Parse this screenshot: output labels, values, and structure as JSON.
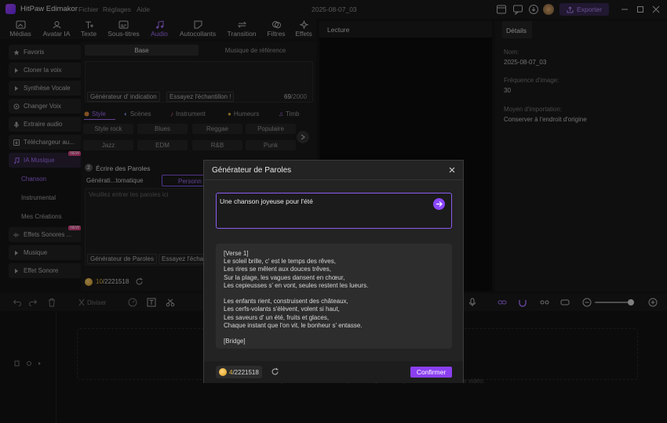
{
  "app": {
    "name": "HitPaw Edimakor",
    "date": "2025-08-07_03",
    "export_label": "Exporter"
  },
  "menu": [
    "Fichier",
    "Réglages",
    "Aide"
  ],
  "toolbar": {
    "items": [
      {
        "label": "Médias",
        "icon": "media-icon"
      },
      {
        "label": "Avatar IA",
        "icon": "avatar-icon"
      },
      {
        "label": "Texte",
        "icon": "text-icon"
      },
      {
        "label": "Sous-titres",
        "icon": "subtitles-icon"
      },
      {
        "label": "Audio",
        "icon": "audio-icon",
        "active": true
      },
      {
        "label": "Autocollants",
        "icon": "stickers-icon"
      },
      {
        "label": "Transition",
        "icon": "transition-icon"
      },
      {
        "label": "Filtres",
        "icon": "filters-icon"
      },
      {
        "label": "Effets",
        "icon": "effects-icon"
      }
    ]
  },
  "sidebar": {
    "items": [
      {
        "label": "Favoris"
      },
      {
        "label": "Cloner la voix"
      },
      {
        "label": "Synthèse Vocale"
      },
      {
        "label": "Changer Voix"
      },
      {
        "label": "Extraire audio"
      },
      {
        "label": "Téléchargeur au..."
      },
      {
        "label": "IA Musique",
        "badge": "NEW",
        "active": true
      },
      {
        "label": "Effets Sonores ...",
        "badge": "NEW"
      },
      {
        "label": "Musique"
      },
      {
        "label": "Effet Sonore"
      }
    ],
    "sub_items": [
      {
        "label": "Chanson",
        "active": true
      },
      {
        "label": "Instrumental"
      },
      {
        "label": "Mes Créations"
      }
    ]
  },
  "center": {
    "tabs": [
      "Base",
      "Musique de référence"
    ],
    "prompt_buttons": [
      "Générateur d' indication",
      "Essayez l'échantillon !"
    ],
    "char_count": "69",
    "char_max": "/2000",
    "style_tabs": [
      "Style",
      "Scènes",
      "Instrument",
      "Humeurs",
      "Timb"
    ],
    "chips": [
      "Style rock",
      "Blues",
      "Reggae",
      "Populaire",
      "Jazz",
      "EDM",
      "R&B",
      "Punk"
    ],
    "lyrics_section": {
      "number": "2",
      "title": "Écrire des Paroles",
      "tab_auto": "Générati...tomatique",
      "tab_custom": "Personn",
      "placeholder": "Veuillez entrer les paroles ici",
      "buttons": [
        "Générateur de Paroles",
        "Essayez l'échan"
      ]
    },
    "credits": {
      "used": "10",
      "total": "/2221518"
    }
  },
  "preview": {
    "title": "Lecture"
  },
  "details": {
    "tab": "Détails",
    "fields": [
      {
        "label": "Nom:",
        "value": "2025-08-07_03"
      },
      {
        "label": "Fréquence d'image:",
        "value": "30"
      },
      {
        "label": "Moyen d'importation:",
        "value": "Conserver à l'endroit d'origine"
      }
    ]
  },
  "timeline_toolbar": {
    "split_label": "Diviser"
  },
  "timeline": {
    "hint": "Glissez et déposez vos fichiers vidéo, audio et photos ici pour commencer votre vidéo."
  },
  "modal": {
    "title": "Générateur de Paroles",
    "prompt": "Une chanson joyeuse pour l'été",
    "lyrics": [
      "[Verse 1]",
      "Le soleil brille, c'  est le temps des rêves,",
      "Les rires se mêlent aux douces trêves,",
      "Sur la plage, les vagues dansent en chœur,",
      "Les cepieusses s'  en vont, seules restent les lueurs.",
      "",
      "Les enfants rient, construisent des châteaux,",
      "Les cerfs-volants s'élèvent, volent si haut,",
      "Les saveurs d'  un été, fruits et glaces,",
      "Chaque instant que l'on vit, le bonheur s'  entasse.",
      "",
      "[Bridge]"
    ],
    "credits": {
      "used": "4",
      "total": "/2221518"
    },
    "confirm_label": "Confirmer"
  }
}
